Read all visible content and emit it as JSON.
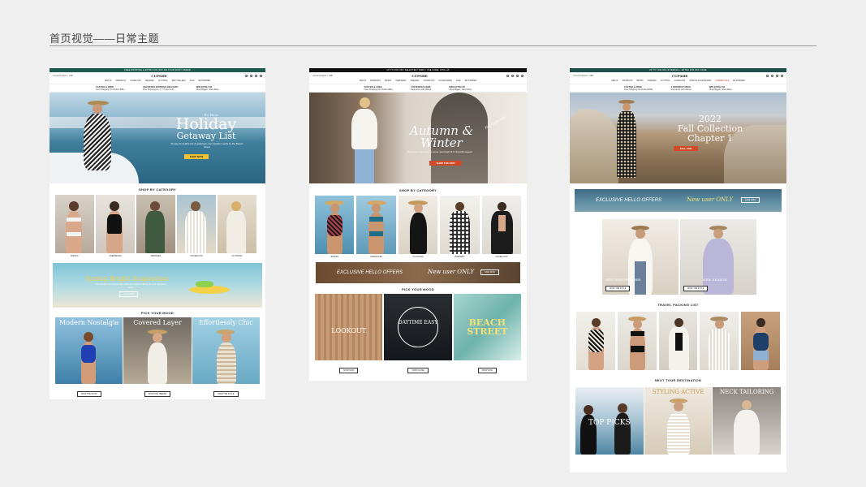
{
  "heading": "首页视觉——日常主题",
  "brand": "CUPSHE",
  "common": {
    "benefit_shipping_title": "FASTER & FREE",
    "benefit_shipping_sub": "Free Shipping On Orders $59+",
    "benefit_returns_title": "UNLIMITED EXPRESS DELIVERY",
    "benefit_returns_sub": "Free Shipping $ + 1 Yr Free Subs",
    "benefit_pay_title": "4 INTEREST-FREE",
    "benefit_pay_sub": "Payments with Klarna",
    "benefit_off_title": "WIN EXTRA $5",
    "benefit_off_sub": "Shop Bigger, Save More",
    "region": "United Kingdom / GBP"
  },
  "mocks": [
    {
      "promo": "FREE SHIPPING & EXTRA 15% OFF ON YOUR FIRST ORDER",
      "nav": [
        "NEW IN",
        "SWIMSUITS",
        "COVER-UPS",
        "DRESSES",
        "CLOTHING",
        "BEST SELLERS",
        "SALE",
        "BE INSPIRED"
      ],
      "hero": {
        "kicker": "It's Here",
        "title1": "Holiday",
        "title2": "Getaway List",
        "sub": "Simply do doable trip & getaways, top vacation ready by the Beach Mood",
        "cta": "SHOP NOW"
      },
      "category_title": "SHOP BY CATEGORY",
      "categories": [
        "BIKINIS",
        "ONEPIECES",
        "DRESSES",
        "COVER-UPS",
        "CLOTHING"
      ],
      "banner": {
        "title": "Spring Bright Inspiration",
        "sub": "Turn heads with flying colors that are bright & vibrant at your next pool party",
        "cta": "SHOP NOW"
      },
      "mood_title": "PICK YOUR MOOD",
      "moods": [
        {
          "title": "Modern Nostalgia",
          "cta": "SHOP THE SUITS"
        },
        {
          "title": "Covered Layer",
          "cta": "SHOP THE TRENDS"
        },
        {
          "title": "Effortlessly Chic",
          "cta": "SHOP THE STYLE"
        }
      ]
    },
    {
      "promo": "UP TO 15% OFF SELECTED ITEMS / USE CODE: CHILL15",
      "nav": [
        "NEW IN",
        "SWIMSUITS",
        "BIKINIS",
        "ONEPIECES",
        "DRESSES",
        "COVER-UPS",
        "ACCESSORIES",
        "SALE",
        "BE INSPIRED"
      ],
      "hero": {
        "kicker": "Fall Collection",
        "title1": "Autumn &",
        "title2": "Winter",
        "sub": "Treat your wardrobe to some new fresh fit in the A/W season",
        "cta": "SHOP THE EDIT"
      },
      "category_title": "SHOP BY CATEGORY",
      "categories": [
        "BIKINIS",
        "ONEPIECES",
        "CLOTHING",
        "DRESSES",
        "COVER-UPS"
      ],
      "offer": {
        "left": "EXCLUSIVE HELLO OFFERS",
        "right": "New user ONLY",
        "cta": "SAVE NOW"
      },
      "mood_title": "PICK YOUR MOOD",
      "moods": [
        {
          "title": "LOOKOUT",
          "cta": "SHOP NOW"
        },
        {
          "title": "DAYTIME EASY",
          "cta": "SHOP CLOSE"
        },
        {
          "title": "BEACH STREET",
          "cta": "SHOP NOW"
        }
      ]
    },
    {
      "promo": "UP TO 70% OFF SITEWIDE + EXTRA 15% OFF CODE",
      "nav": [
        "NEW IN",
        "SWIMSUITS",
        "BIKINIS",
        "DRESSES",
        "CLOTHING",
        "COVER-UPS",
        "SHOES & ACCESSORIES",
        "SUMMER SALE",
        "BE INSPIRED"
      ],
      "hero": {
        "kicker": "2022",
        "title1": "Fall Collection",
        "title2": "Chapter 1",
        "cta": "FALL FUN"
      },
      "offer": {
        "left": "EXCLUSIVE HELLO OFFERS",
        "right": "New user ONLY",
        "cta": "SAVE NOW"
      },
      "pair": [
        {
          "title": "WESTERN WONDER",
          "cta": "SHOP THE STYLE"
        },
        {
          "title": "NEW SEASON",
          "cta": "SHOP THE STYLE"
        }
      ],
      "packing_title": "TRAVEL PACKING LIST",
      "destination_title": "NEXT TOUR DESTINATION",
      "destinations": [
        {
          "title": "TOP PICKS"
        },
        {
          "title": "STYLING ACTIVE"
        },
        {
          "title": "NECK TAILORING"
        }
      ]
    }
  ]
}
